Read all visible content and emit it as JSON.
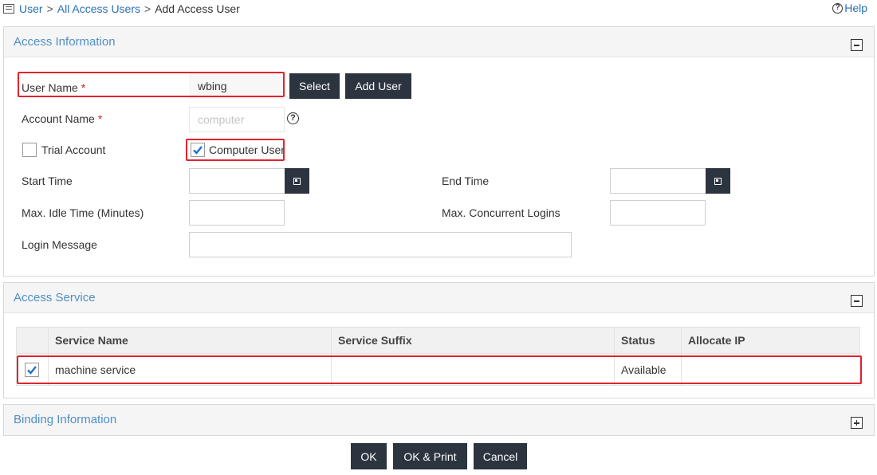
{
  "breadcrumb": {
    "item1": "User",
    "item2": "All Access Users",
    "item3": "Add Access User",
    "sep": ">"
  },
  "help": {
    "label": "Help"
  },
  "access_info": {
    "title": "Access Information",
    "user_name_label": "User Name",
    "required_mark": "*",
    "user_name_value": "wbing",
    "select_btn": "Select",
    "add_user_btn": "Add User",
    "account_name_label": "Account Name",
    "account_name_placeholder": "computer",
    "trial_account_label": "Trial Account",
    "trial_account_checked": false,
    "computer_user_label": "Computer User",
    "computer_user_checked": true,
    "start_time_label": "Start Time",
    "start_time_value": "",
    "end_time_label": "End Time",
    "end_time_value": "",
    "max_idle_label": "Max. Idle Time (Minutes)",
    "max_idle_value": "",
    "max_concurrent_label": "Max. Concurrent Logins",
    "max_concurrent_value": "",
    "login_message_label": "Login Message",
    "login_message_value": ""
  },
  "access_service": {
    "title": "Access Service",
    "columns": [
      "Service Name",
      "Service Suffix",
      "Status",
      "Allocate IP"
    ],
    "rows": [
      {
        "checked": true,
        "service_name": "machine service",
        "service_suffix": "",
        "status": "Available",
        "allocate_ip": ""
      }
    ]
  },
  "binding_info": {
    "title": "Binding Information"
  },
  "footer": {
    "ok": "OK",
    "ok_print": "OK & Print",
    "cancel": "Cancel"
  },
  "colors": {
    "accent": "#4f8fc8",
    "button": "#2c3440",
    "highlight": "#e0232d",
    "link": "#2a6fb7"
  }
}
